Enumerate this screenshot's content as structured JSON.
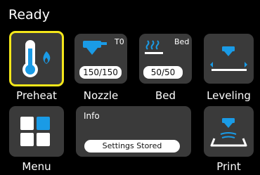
{
  "status": {
    "title": "Ready"
  },
  "tiles": {
    "preheat": {
      "label": "Preheat",
      "icon": "thermometer-flame-icon"
    },
    "nozzle": {
      "label": "Nozzle",
      "tool": "T0",
      "temp": "150/150",
      "icon": "nozzle-icon"
    },
    "bed": {
      "label": "Bed",
      "tool": "Bed",
      "temp": "50/50",
      "icon": "bed-heat-icon"
    },
    "leveling": {
      "label": "Leveling",
      "icon": "leveling-icon"
    },
    "menu": {
      "label": "Menu",
      "icon": "menu-grid-icon"
    },
    "print": {
      "label": "Print",
      "icon": "print-icon"
    }
  },
  "info": {
    "title": "Info",
    "message": "Settings Stored"
  },
  "colors": {
    "accent": "#1a9be6",
    "selection": "#f4e71a",
    "tile": "#3a3a3a",
    "thermo": "#1a9be6"
  }
}
